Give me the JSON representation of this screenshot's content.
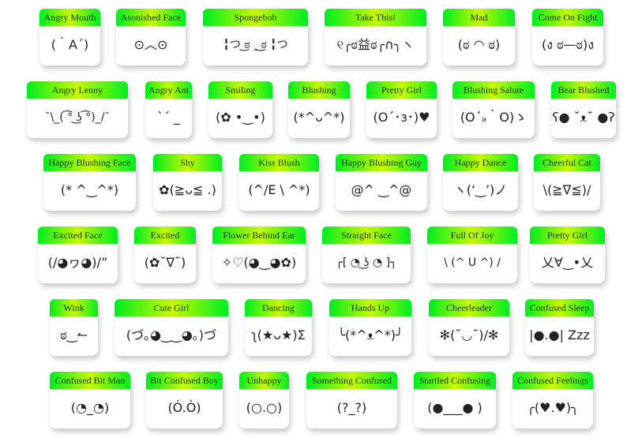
{
  "cards": [
    {
      "title": "Angry Mouth",
      "face": "(｀A´)"
    },
    {
      "title": "Asonished Face",
      "face": "⊙︿⊙"
    },
    {
      "title": "Spongebob",
      "face": "╏つ ͜ಠ ‸ ͜ಠ ╏つ"
    },
    {
      "title": "Take This!",
      "face": "୧╭ಠ益ಠ╭∩╮ヽ"
    },
    {
      "title": "Mad",
      "face": "(ಠ ◠ ಠ)"
    },
    {
      "title": "Come On Fight",
      "face": "(ง ಠ—ಠ)ง"
    },
    {
      "title": "Angry Lenny",
      "face": "¯\\_( ͡° ͜ʖ ͡°)_/¯"
    },
    {
      "title": "Angry Ant",
      "face": "`´ _"
    },
    {
      "title": "Smiling",
      "face": "(✿ •‿•)"
    },
    {
      "title": "Blushing",
      "face": "(*^ᴗ^*)"
    },
    {
      "title": "Pretty Girl",
      "face": "(O´･з･)♥"
    },
    {
      "title": "Blushing Salute",
      "face": "(O´ₔ｀O)ゝ"
    },
    {
      "title": "Bear Blushed",
      "face": "ʕ● ˘ᴥ˘ ●ʔ"
    },
    {
      "title": "Happy Blushing Face",
      "face": "(* ^‿^*)"
    },
    {
      "title": "Shy",
      "face": "✿(≧ᴗ≦ .)"
    },
    {
      "title": "Kiss Blush",
      "face": "(^/E \\ ^*)"
    },
    {
      "title": "Happy Blushing Guy",
      "face": "@^ ‿^@"
    },
    {
      "title": "Happy Dance",
      "face": "ヽ(‘‿’)ノ"
    },
    {
      "title": "Cheerful Cat",
      "face": "\\(≧∇≦)/"
    },
    {
      "title": "Excited Face",
      "face": "(/◕ヮ◕)/”"
    },
    {
      "title": "Excited",
      "face": "(✿˘∇˘)"
    },
    {
      "title": "Flower Behind Ear",
      "face": "✧♡(◕‿◕✿)"
    },
    {
      "title": "Straight Face",
      "face": "┌[ ◔ ͜ʖ ◔ ]┐"
    },
    {
      "title": "Full Of Joy",
      "face": "\\ (^ U ^) /"
    },
    {
      "title": "Pretty Girl",
      "face": "乂∀‿•乂"
    },
    {
      "title": "Wink",
      "face": "ಠ‿↼"
    },
    {
      "title": "Cute Girl",
      "face": "(づ｡◕‿‿◕｡)づ"
    },
    {
      "title": "Dancing",
      "face": "ʅ(★ᴗ★)Σ"
    },
    {
      "title": "Hands Up",
      "face": "╰(*^ᴥ^*)╯"
    },
    {
      "title": "Cheerleader",
      "face": "✻(˘◡˘)/✻"
    },
    {
      "title": "Confused Sleep",
      "face": "|●.●| Zzz"
    },
    {
      "title": "Confused Bit Man",
      "face": "(◔_◔)"
    },
    {
      "title": "Bit Confused Boy",
      "face": "(Ó.Ò)"
    },
    {
      "title": "Unhappy",
      "face": "(○.○)"
    },
    {
      "title": "Something Confused",
      "face": "(?_?)"
    },
    {
      "title": "Startled Confusing",
      "face": "(●___● )"
    },
    {
      "title": "Confused Feelings",
      "face": "╭(♥.♥)╮"
    }
  ]
}
